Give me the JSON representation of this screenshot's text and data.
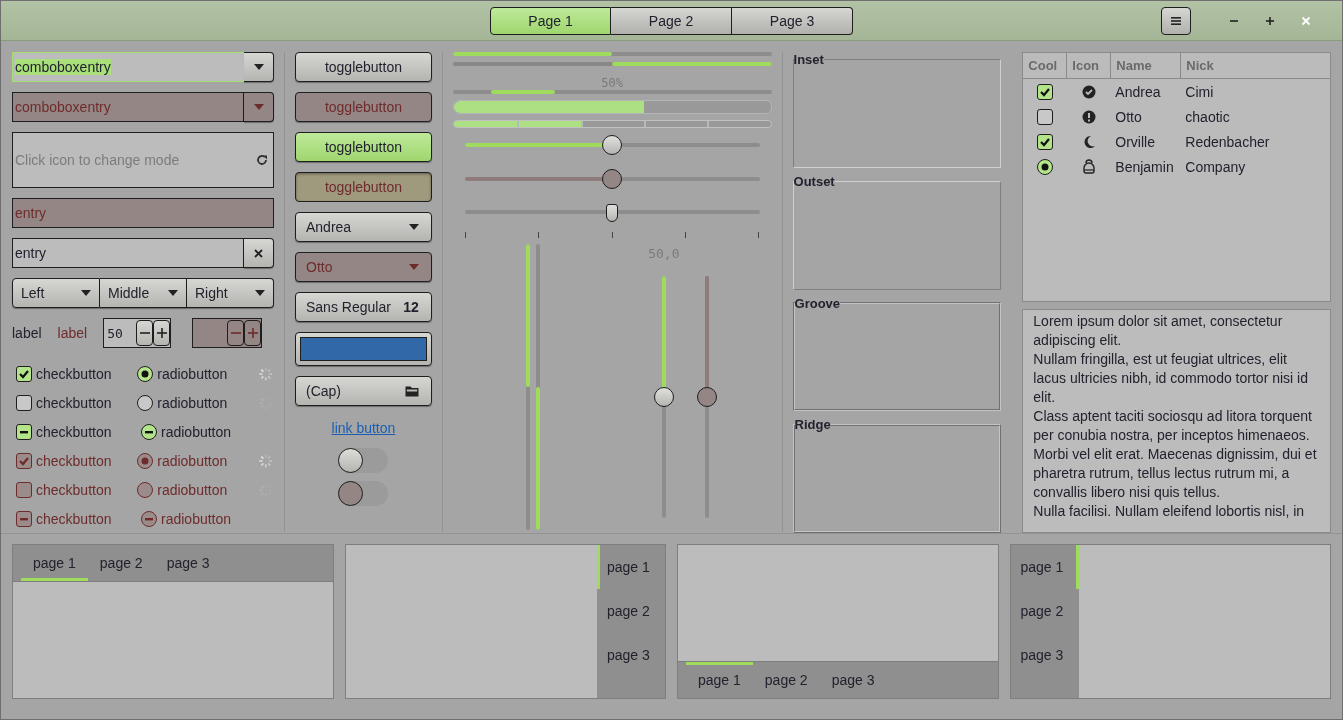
{
  "header": {
    "tabs": [
      {
        "label": "Page 1",
        "selected": true
      },
      {
        "label": "Page 2",
        "selected": false
      },
      {
        "label": "Page 3",
        "selected": false
      }
    ]
  },
  "combo_entries": [
    {
      "value": "comboboxentry",
      "focused": true,
      "disabled": false
    },
    {
      "value": "comboboxentry",
      "focused": false,
      "disabled": true
    }
  ],
  "mode_entry": {
    "placeholder": "Click icon to change mode"
  },
  "entries": [
    {
      "value": "entry",
      "disabled": true,
      "clear_button": false
    },
    {
      "value": "entry",
      "disabled": false,
      "clear_button": true
    }
  ],
  "linked_combos": [
    "Left",
    "Middle",
    "Right"
  ],
  "labels": [
    {
      "text": "label",
      "disabled": false
    },
    {
      "text": "label",
      "disabled": true
    }
  ],
  "spin_buttons": [
    {
      "value": "50",
      "disabled": false
    },
    {
      "disabled": true
    }
  ],
  "check_rows": [
    {
      "check": {
        "label": "checkbutton",
        "checked": true,
        "inconsistent": false,
        "disabled": false
      },
      "radio": {
        "label": "radiobutton",
        "checked": true,
        "inconsistent": false,
        "disabled": false
      },
      "spinner": {
        "active": true
      }
    },
    {
      "check": {
        "label": "checkbutton",
        "checked": false,
        "inconsistent": false,
        "disabled": false
      },
      "radio": {
        "label": "radiobutton",
        "checked": false,
        "inconsistent": false,
        "disabled": false
      },
      "spinner": {
        "active": false
      }
    },
    {
      "check": {
        "label": "checkbutton",
        "inconsistent": true,
        "disabled": false
      },
      "radio": {
        "label": "radiobutton",
        "inconsistent": true,
        "disabled": false
      }
    },
    {
      "check": {
        "label": "checkbutton",
        "checked": true,
        "inconsistent": false,
        "disabled": true
      },
      "radio": {
        "label": "radiobutton",
        "checked": true,
        "inconsistent": false,
        "disabled": true
      },
      "spinner": {
        "active": true
      }
    },
    {
      "check": {
        "label": "checkbutton",
        "checked": false,
        "inconsistent": false,
        "disabled": true
      },
      "radio": {
        "label": "radiobutton",
        "checked": false,
        "inconsistent": false,
        "disabled": true
      },
      "spinner": {
        "active": false
      }
    },
    {
      "check": {
        "label": "checkbutton",
        "inconsistent": true,
        "disabled": true
      },
      "radio": {
        "label": "radiobutton",
        "inconsistent": true,
        "disabled": true
      }
    }
  ],
  "toggle_buttons": [
    {
      "label": "togglebutton",
      "active": false,
      "disabled": false
    },
    {
      "label": "togglebutton",
      "active": false,
      "disabled": true
    },
    {
      "label": "togglebutton",
      "active": true,
      "disabled": false
    },
    {
      "label": "togglebutton",
      "active": true,
      "disabled": true
    }
  ],
  "combos": [
    {
      "value": "Andrea",
      "disabled": false
    },
    {
      "value": "Otto",
      "disabled": true
    }
  ],
  "font_button": {
    "family": "Sans Regular",
    "size": "12"
  },
  "color_button": {
    "color": "#3068a8"
  },
  "file_button": {
    "label": "(Cap)"
  },
  "link_button": {
    "label": "link button"
  },
  "switches": [
    {
      "on": false,
      "disabled": false
    },
    {
      "on": false,
      "disabled": true
    }
  ],
  "progress_bars": [
    {
      "kind": "thin",
      "level": 0.5,
      "inverted": false
    },
    {
      "kind": "thin",
      "level": 0.5,
      "inverted": true
    },
    {
      "kind": "pulse",
      "text": "50%"
    },
    {
      "kind": "thick",
      "level": 0.6
    },
    {
      "kind": "segmented",
      "level": 0.4
    }
  ],
  "hscales": [
    {
      "level": 0.5,
      "disabled": false,
      "marks": false
    },
    {
      "level": 0.5,
      "disabled": true,
      "marks": false
    },
    {
      "level": 0.5,
      "marks": true
    }
  ],
  "vprogress": [
    {
      "level": 0.5,
      "inverted": false
    },
    {
      "level": 0.5,
      "inverted": true
    }
  ],
  "vscales": [
    {
      "level": 0.5,
      "reading": "50,0",
      "disabled": false
    },
    {
      "level": 0.5,
      "disabled": true
    }
  ],
  "frames": [
    {
      "label": "Inset",
      "kind": "inset"
    },
    {
      "label": "Outset",
      "kind": "outset"
    },
    {
      "label": "Groove",
      "kind": "groove"
    },
    {
      "label": "Ridge",
      "kind": "ridge"
    }
  ],
  "tree": {
    "columns": [
      "Cool",
      "Icon",
      "Name",
      "Nick"
    ],
    "rows": [
      {
        "cool": {
          "kind": "check",
          "checked": true
        },
        "icon": {
          "kind": "check"
        },
        "name": "Andrea",
        "nick": "Cimi"
      },
      {
        "cool": {
          "kind": "check",
          "checked": false
        },
        "icon": {
          "kind": "alert"
        },
        "name": "Otto",
        "nick": "chaotic"
      },
      {
        "cool": {
          "kind": "check",
          "checked": true
        },
        "icon": {
          "kind": "moon"
        },
        "name": "Orville",
        "nick": "Redenbacher"
      },
      {
        "cool": {
          "kind": "radio",
          "checked": true
        },
        "icon": {
          "kind": "emblem"
        },
        "name": "Benjamin",
        "nick": "Company"
      }
    ]
  },
  "text_view": {
    "paragraphs": [
      "Lorem ipsum dolor sit amet, consectetur adipiscing elit.",
      "Nullam fringilla, est ut feugiat ultrices, elit lacus ultricies nibh, id commodo tortor nisi id elit.",
      "Class aptent taciti sociosqu ad litora torquent per conubia nostra, per inceptos himenaeos.",
      "Morbi vel elit erat. Maecenas dignissim, dui et pharetra rutrum, tellus lectus rutrum mi, a convallis libero nisi quis tellus.",
      "Nulla facilisi. Nullam eleifend lobortis nisl, in"
    ]
  },
  "notebooks": [
    {
      "kind": "top",
      "tabs": [
        {
          "label": "page 1",
          "selected": true
        },
        {
          "label": "page 2",
          "selected": false
        },
        {
          "label": "page 3",
          "selected": false
        }
      ]
    },
    {
      "kind": "right",
      "tabs": [
        {
          "label": "page 1",
          "selected": true
        },
        {
          "label": "page 2",
          "selected": false
        },
        {
          "label": "page 3",
          "selected": false
        }
      ]
    },
    {
      "kind": "bottom",
      "tabs": [
        {
          "label": "page 1",
          "selected": true
        },
        {
          "label": "page 2",
          "selected": false
        },
        {
          "label": "page 3",
          "selected": false
        }
      ]
    },
    {
      "kind": "left",
      "tabs": [
        {
          "label": "page 1",
          "selected": true
        },
        {
          "label": "page 2",
          "selected": false
        },
        {
          "label": "page 3",
          "selected": false
        }
      ]
    }
  ]
}
